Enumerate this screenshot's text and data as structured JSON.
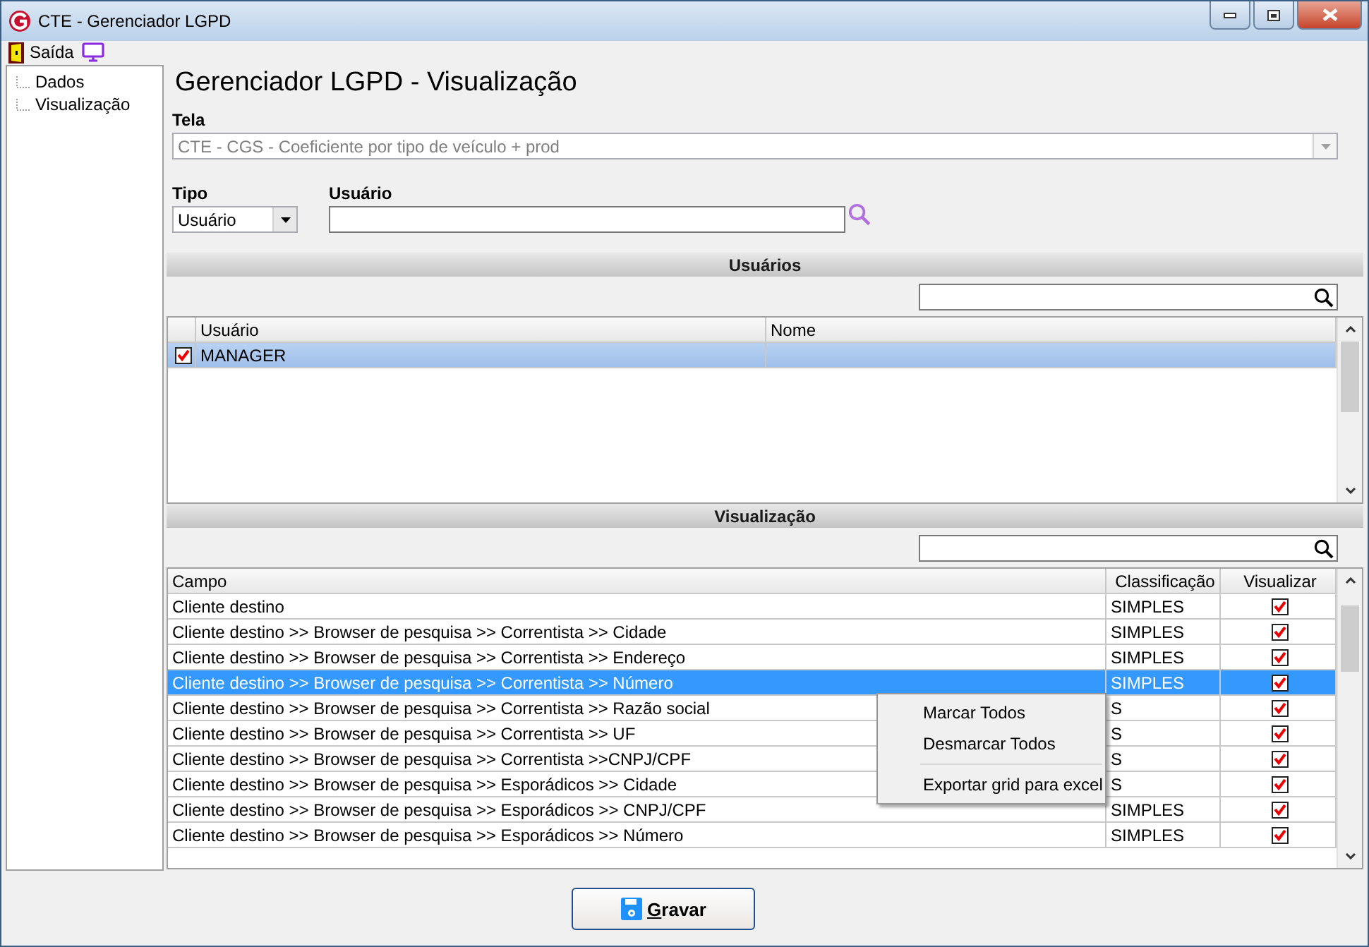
{
  "window": {
    "title": "CTE - Gerenciador LGPD"
  },
  "toolbar": [
    {
      "kind": "exit",
      "label": "Saída"
    },
    {
      "kind": "monitor"
    }
  ],
  "sidebar": {
    "items": [
      {
        "label": "Dados"
      },
      {
        "label": "Visualização"
      }
    ]
  },
  "heading": "Gerenciador LGPD - Visualização",
  "tela": {
    "label": "Tela",
    "value": "CTE - CGS - Coeficiente por tipo de veículo + prod",
    "disabled": true
  },
  "tipo": {
    "label": "Tipo",
    "value": "Usuário"
  },
  "usuario": {
    "label": "Usuário"
  },
  "usuarios": {
    "title": "Usuários",
    "columns": [
      "Usuário",
      "Nome"
    ],
    "rows": [
      {
        "checked": true,
        "usuario": "MANAGER",
        "selected": true
      }
    ]
  },
  "visualizacao": {
    "title": "Visualização",
    "columns": [
      "Campo",
      "Classificação",
      "Visualizar"
    ],
    "rows": [
      {
        "campo": "Cliente destino",
        "classificacao": "SIMPLES",
        "visualizar": true,
        "selected": false
      },
      {
        "campo": "Cliente destino >> Browser de pesquisa >> Correntista >> Cidade",
        "classificacao": "SIMPLES",
        "visualizar": true,
        "selected": false
      },
      {
        "campo": "Cliente destino >> Browser de pesquisa >> Correntista >> Endereço",
        "classificacao": "SIMPLES",
        "visualizar": true,
        "selected": false
      },
      {
        "campo": "Cliente destino >> Browser de pesquisa >> Correntista >> Número",
        "classificacao": "SIMPLES",
        "visualizar": true,
        "selected": true
      },
      {
        "campo": "Cliente destino >> Browser de pesquisa >> Correntista >> Razão social",
        "classificacao": "S",
        "visualizar": true,
        "selected": false
      },
      {
        "campo": "Cliente destino >> Browser de pesquisa >> Correntista >> UF",
        "classificacao": "S",
        "visualizar": true,
        "selected": false
      },
      {
        "campo": "Cliente destino >> Browser de pesquisa >> Correntista >>CNPJ/CPF",
        "classificacao": "S",
        "visualizar": true,
        "selected": false
      },
      {
        "campo": "Cliente destino >> Browser de pesquisa >> Esporádicos >> Cidade",
        "classificacao": "S",
        "visualizar": true,
        "selected": false
      },
      {
        "campo": "Cliente destino >> Browser de pesquisa >> Esporádicos >> CNPJ/CPF",
        "classificacao": "SIMPLES",
        "visualizar": true,
        "selected": false
      },
      {
        "campo": "Cliente destino >> Browser de pesquisa >> Esporádicos >> Número",
        "classificacao": "SIMPLES",
        "visualizar": true,
        "selected": false
      }
    ]
  },
  "context_menu": {
    "items": [
      {
        "kind": "item",
        "label": "Marcar Todos"
      },
      {
        "kind": "item",
        "label": "Desmarcar Todos"
      },
      {
        "kind": "separator"
      },
      {
        "kind": "item",
        "label": "Exportar grid para excel"
      }
    ]
  },
  "save_button": {
    "label": "Gravar"
  }
}
